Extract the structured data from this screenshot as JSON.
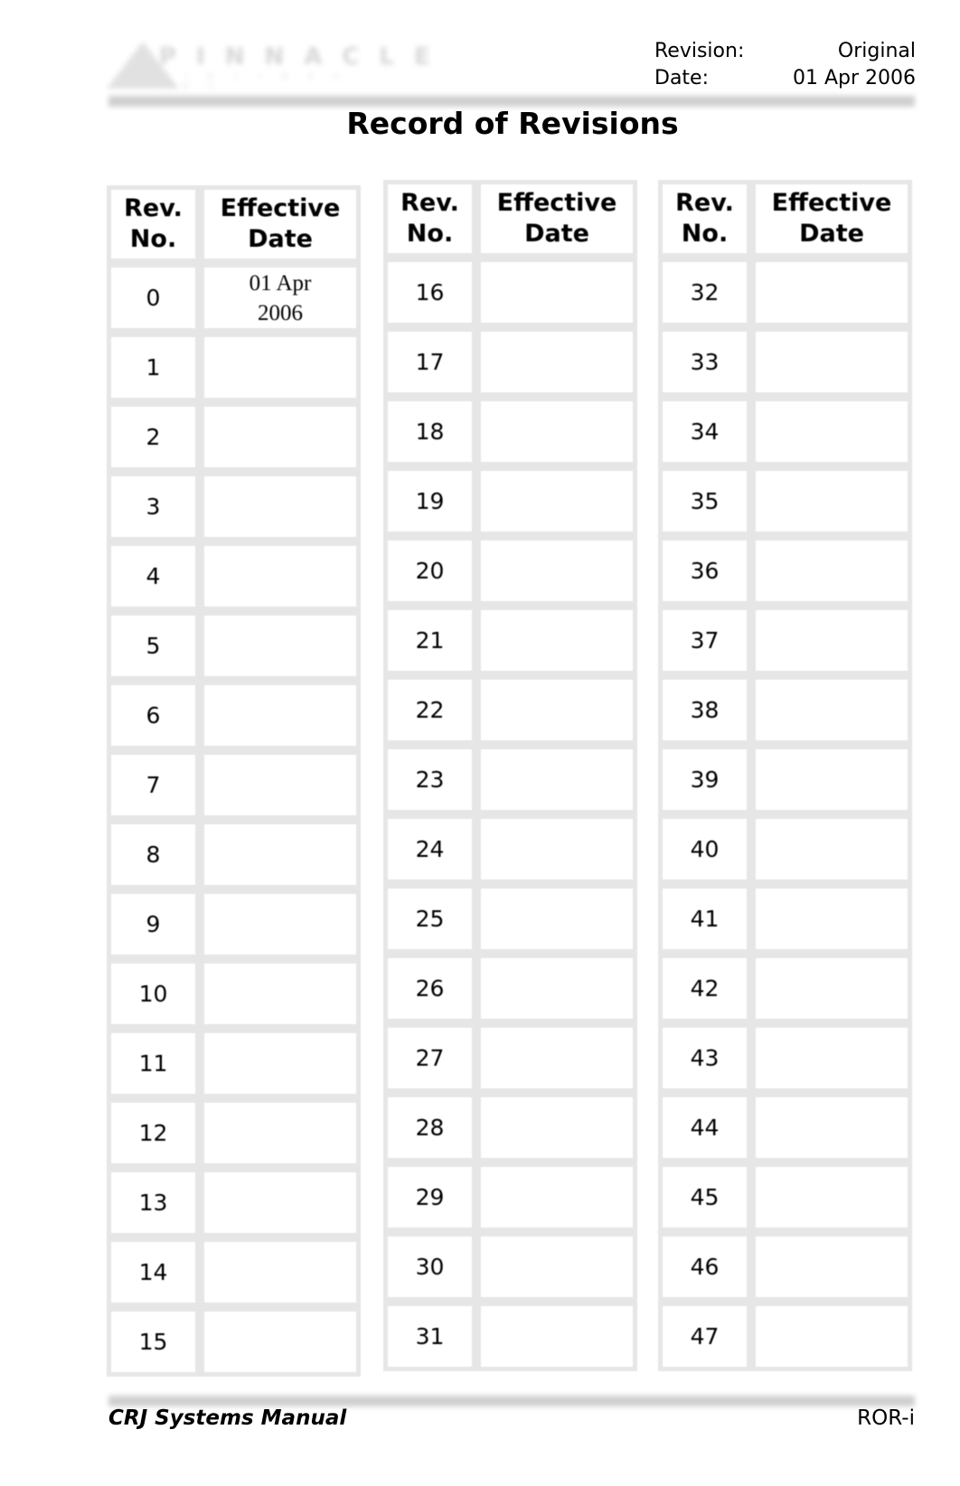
{
  "header": {
    "logo": {
      "letters": "PINNACLE",
      "subtext": "AIRLINES INC"
    },
    "revision_label": "Revision:",
    "revision_value": "Original",
    "date_label": "Date:",
    "date_value": "01 Apr 2006"
  },
  "title": "Record of Revisions",
  "table": {
    "col_rev_header": "Rev. No.",
    "col_date_header": "Effective Date",
    "groups": [
      {
        "rows": [
          {
            "rev": "0",
            "date": "01 Apr 2006"
          },
          {
            "rev": "1",
            "date": ""
          },
          {
            "rev": "2",
            "date": ""
          },
          {
            "rev": "3",
            "date": ""
          },
          {
            "rev": "4",
            "date": ""
          },
          {
            "rev": "5",
            "date": ""
          },
          {
            "rev": "6",
            "date": ""
          },
          {
            "rev": "7",
            "date": ""
          },
          {
            "rev": "8",
            "date": ""
          },
          {
            "rev": "9",
            "date": ""
          },
          {
            "rev": "10",
            "date": ""
          },
          {
            "rev": "11",
            "date": ""
          },
          {
            "rev": "12",
            "date": ""
          },
          {
            "rev": "13",
            "date": ""
          },
          {
            "rev": "14",
            "date": ""
          },
          {
            "rev": "15",
            "date": ""
          }
        ]
      },
      {
        "rows": [
          {
            "rev": "16",
            "date": ""
          },
          {
            "rev": "17",
            "date": ""
          },
          {
            "rev": "18",
            "date": ""
          },
          {
            "rev": "19",
            "date": ""
          },
          {
            "rev": "20",
            "date": ""
          },
          {
            "rev": "21",
            "date": ""
          },
          {
            "rev": "22",
            "date": ""
          },
          {
            "rev": "23",
            "date": ""
          },
          {
            "rev": "24",
            "date": ""
          },
          {
            "rev": "25",
            "date": ""
          },
          {
            "rev": "26",
            "date": ""
          },
          {
            "rev": "27",
            "date": ""
          },
          {
            "rev": "28",
            "date": ""
          },
          {
            "rev": "29",
            "date": ""
          },
          {
            "rev": "30",
            "date": ""
          },
          {
            "rev": "31",
            "date": ""
          }
        ]
      },
      {
        "rows": [
          {
            "rev": "32",
            "date": ""
          },
          {
            "rev": "33",
            "date": ""
          },
          {
            "rev": "34",
            "date": ""
          },
          {
            "rev": "35",
            "date": ""
          },
          {
            "rev": "36",
            "date": ""
          },
          {
            "rev": "37",
            "date": ""
          },
          {
            "rev": "38",
            "date": ""
          },
          {
            "rev": "39",
            "date": ""
          },
          {
            "rev": "40",
            "date": ""
          },
          {
            "rev": "41",
            "date": ""
          },
          {
            "rev": "42",
            "date": ""
          },
          {
            "rev": "43",
            "date": ""
          },
          {
            "rev": "44",
            "date": ""
          },
          {
            "rev": "45",
            "date": ""
          },
          {
            "rev": "46",
            "date": ""
          },
          {
            "rev": "47",
            "date": ""
          }
        ]
      }
    ]
  },
  "footer": {
    "manual_name": "CRJ Systems Manual",
    "page_id": "ROR-i"
  }
}
